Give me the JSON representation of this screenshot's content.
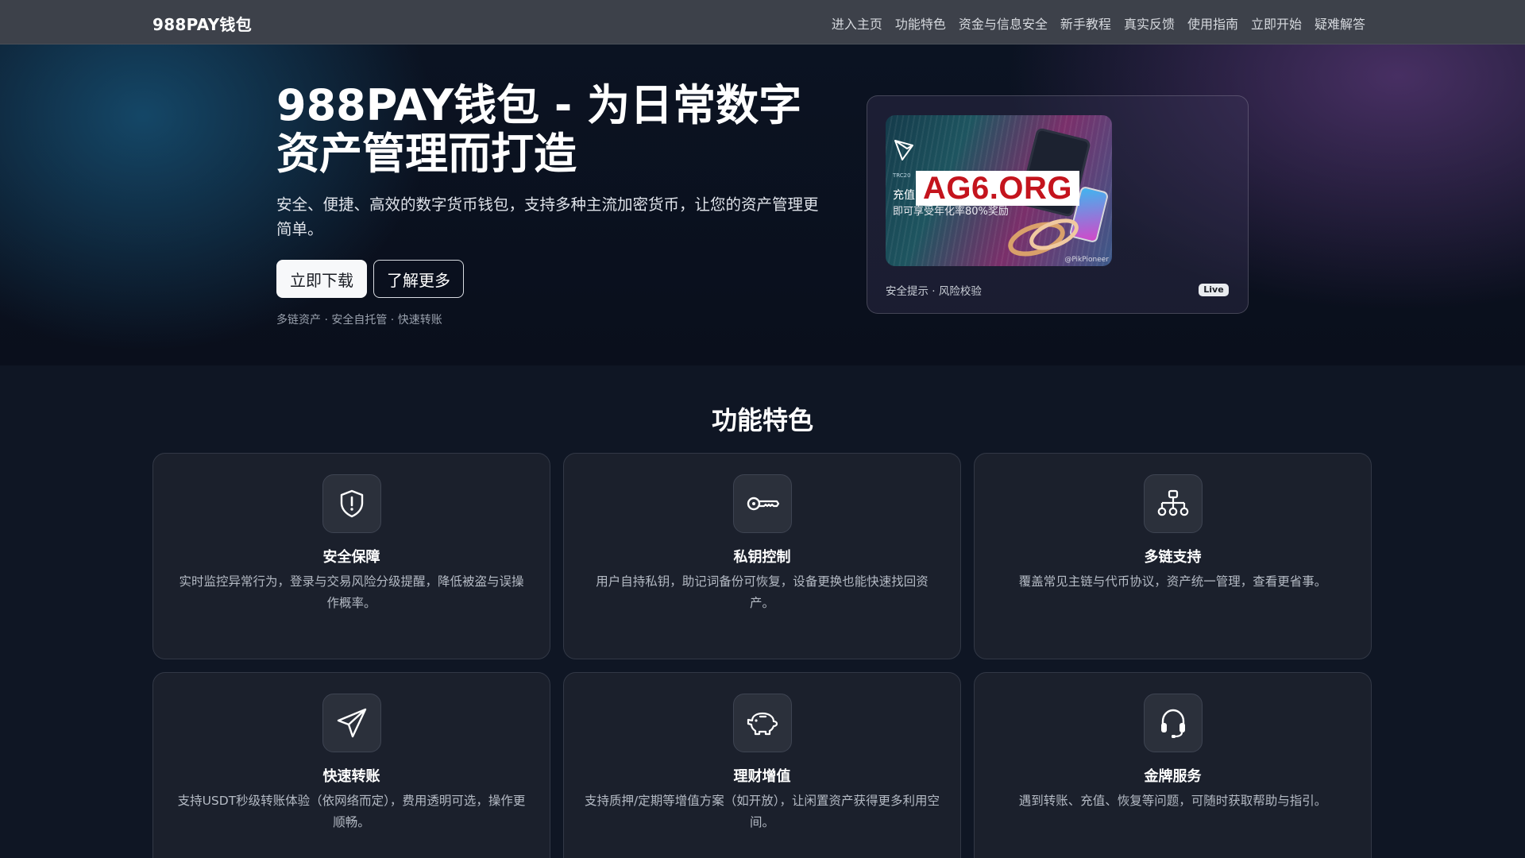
{
  "brand": "988PAY钱包",
  "nav": [
    "进入主页",
    "功能特色",
    "资金与信息安全",
    "新手教程",
    "真实反馈",
    "使用指南",
    "立即开始",
    "疑难解答"
  ],
  "hero": {
    "title": "988PAY钱包 - 为日常数字资产管理而打造",
    "subtitle": "安全、便捷、高效的数字货币钱包，支持多种主流加密货币，让您的资产管理更简单。",
    "download_label": "立即下载",
    "more_label": "了解更多",
    "tagline": "多链资产 · 安全自托管 · 快速转账"
  },
  "hero_card": {
    "promo": {
      "small_text": "TRC20",
      "line1": "充值",
      "line2": "即可享受年化率80%奖励",
      "watermark": "AG6.ORG",
      "credit": "@PikPioneer"
    },
    "caption": "安全提示 · 风险校验",
    "badge": "Live"
  },
  "features": {
    "title": "功能特色",
    "items": [
      {
        "icon": "shield-alert-icon",
        "title": "安全保障",
        "desc": "实时监控异常行为，登录与交易风险分级提醒，降低被盗与误操作概率。"
      },
      {
        "icon": "key-icon",
        "title": "私钥控制",
        "desc": "用户自持私钥，助记词备份可恢复，设备更换也能快速找回资产。"
      },
      {
        "icon": "network-icon",
        "title": "多链支持",
        "desc": "覆盖常见主链与代币协议，资产统一管理，查看更省事。"
      },
      {
        "icon": "paper-plane-icon",
        "title": "快速转账",
        "desc": "支持USDT秒级转账体验（依网络而定），费用透明可选，操作更顺畅。"
      },
      {
        "icon": "piggy-bank-icon",
        "title": "理财增值",
        "desc": "支持质押/定期等增值方案（如开放），让闲置资产获得更多利用空间。"
      },
      {
        "icon": "headset-icon",
        "title": "金牌服务",
        "desc": "遇到转账、充值、恢复等问题，可随时获取帮助与指引。"
      }
    ]
  },
  "colors": {
    "navbar": "#3d414a",
    "page_bg": "#0f1624",
    "card_bg": "#1b202c",
    "watermark_red": "#c4141d"
  }
}
